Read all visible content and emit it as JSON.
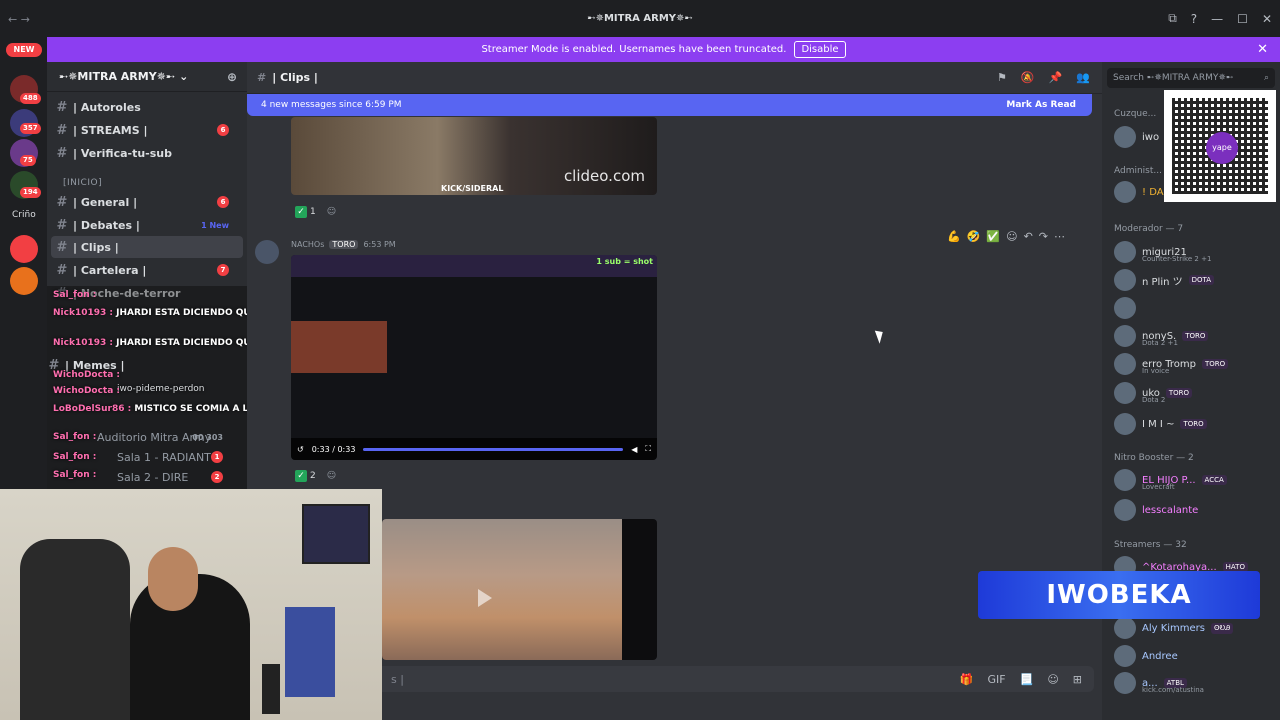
{
  "window": {
    "title": "➸✵MITRA ARMY✵➸",
    "back": "←",
    "forward": "→",
    "controls": [
      "⧉",
      "?",
      "—",
      "☐",
      "✕"
    ]
  },
  "banner": {
    "text": "Streamer Mode is enabled. Usernames have been truncated.",
    "button": "Disable",
    "close": "✕"
  },
  "guilds": {
    "new_label": "NEW",
    "badges": [
      "488",
      "357",
      "75",
      "194"
    ],
    "label": "Criño"
  },
  "server": {
    "name": "➸✵MITRA ARMY✵➸",
    "chevron": "⌄",
    "add_icon": "⊕"
  },
  "channels": [
    {
      "name": "| Autoroles",
      "badge": "",
      "new": ""
    },
    {
      "name": "| STREAMS |",
      "badge": "6",
      "new": ""
    },
    {
      "name": "| Verifica-tu-sub",
      "badge": "",
      "new": ""
    },
    {
      "name": "| General |",
      "badge": "6",
      "new": ""
    },
    {
      "name": "| Debates |",
      "badge": "",
      "new": "1 New"
    },
    {
      "name": "| Clips |",
      "badge": "",
      "new": ""
    },
    {
      "name": "| Cartelera |",
      "badge": "7",
      "new": ""
    },
    {
      "name": "| Noche-de-terror",
      "badge": "",
      "new": ""
    },
    {
      "name": "| Memes |",
      "badge": "",
      "new": ""
    },
    {
      "name": "iwo-pideme-perdon",
      "badge": "",
      "new": ""
    }
  ],
  "categories": {
    "inicio": "[INICIO]"
  },
  "voice": [
    {
      "name": "Auditorio Mitra Army",
      "count": "00 303"
    },
    {
      "name": "Sala 1 - RADIANT",
      "count": "1"
    },
    {
      "name": "Sala 2 - DIRE",
      "count": "2"
    }
  ],
  "overlay_chat": [
    {
      "user": "Sal_fon :",
      "text": ""
    },
    {
      "user": "Nick10193 :",
      "text": "JHARDI ESTA DICIENDO QUE LA PULSEABAS"
    },
    {
      "user": "Nick10193 :",
      "text": "JHARDI ESTA DICIENDO QUE LA PULSEABAS"
    },
    {
      "user": "WichoDocta :",
      "text": ""
    },
    {
      "user": "WichoDocta :",
      "text": ""
    },
    {
      "user": "LoBoDelSur86 :",
      "text": "MISTICO SE COMIA A LA POLLERA Y A ESCONDIDAS A YARIT"
    },
    {
      "user": "Sal_fon :",
      "text": ""
    },
    {
      "user": "Sal_fon :",
      "text": ""
    },
    {
      "user": "Sal_fon :",
      "text": ""
    }
  ],
  "channel_header": {
    "name": "| Clips |",
    "icons": [
      "⚑",
      "🔕",
      "📌",
      "👥"
    ]
  },
  "new_messages": {
    "text": "4 new messages since 6:59 PM",
    "mark": "Mark As Read"
  },
  "messages": {
    "first_reaction_count": "1",
    "author_meta": "NACHOs",
    "author_tag": "TORO",
    "time": "6:53 PM",
    "video_time": "0:33 / 0:33",
    "second_reaction_count": "2",
    "watermark": "clideo.com",
    "kick_label": "KICK/SIDERAL",
    "video_title": "1 sub = shot"
  },
  "message_tools": [
    "💪",
    "🤣",
    "✅",
    "☺",
    "↶",
    "↷",
    "⋯"
  ],
  "composer": {
    "placeholder": "s |",
    "icons": [
      "🎁",
      "GIF",
      "📃",
      "☺",
      "⊞"
    ]
  },
  "search": {
    "placeholder": "Search ➸✵MITRA ARMY✵➸"
  },
  "member_groups": [
    {
      "label": "Cuzque..."
    },
    {
      "label": "Administ..."
    },
    {
      "label": "Moderador — 7"
    },
    {
      "label": "Nitro Booster — 2"
    },
    {
      "label": "Streamers — 32"
    }
  ],
  "members": [
    {
      "name": "iwo",
      "tag": "",
      "sub": ""
    },
    {
      "name": "! DA",
      "tag": "",
      "sub": ""
    },
    {
      "name": "miguri21",
      "tag": "",
      "sub": "Counter-Strike 2 +1"
    },
    {
      "name": "n Plin ツ",
      "tag": "DOTA",
      "sub": ""
    },
    {
      "name": "nonyS.",
      "tag": "TORO",
      "sub": "Dota 2 +1"
    },
    {
      "name": "erro Tromp",
      "tag": "TORO",
      "sub": "In voice"
    },
    {
      "name": "uko",
      "tag": "TORO",
      "sub": "Dota 2"
    },
    {
      "name": "I M I ~",
      "tag": "TORO",
      "sub": ""
    },
    {
      "name": "EL HIJO P...",
      "tag": "ACCA",
      "sub": "Lovecraft"
    },
    {
      "name": "lesscalante",
      "tag": "",
      "sub": ""
    },
    {
      "name": "^Kotarohaya...",
      "tag": "HATO",
      "sub": ""
    },
    {
      "name": "Aly Kimmers",
      "tag": "ʘᎧᎯ",
      "sub": ""
    },
    {
      "name": "Andree",
      "tag": "",
      "sub": ""
    },
    {
      "name": "a...",
      "tag": "ATBL",
      "sub": "kick.com/atustina"
    }
  ],
  "brand": {
    "text": "IWOBEKA"
  },
  "qr": {
    "logo": "yape"
  }
}
